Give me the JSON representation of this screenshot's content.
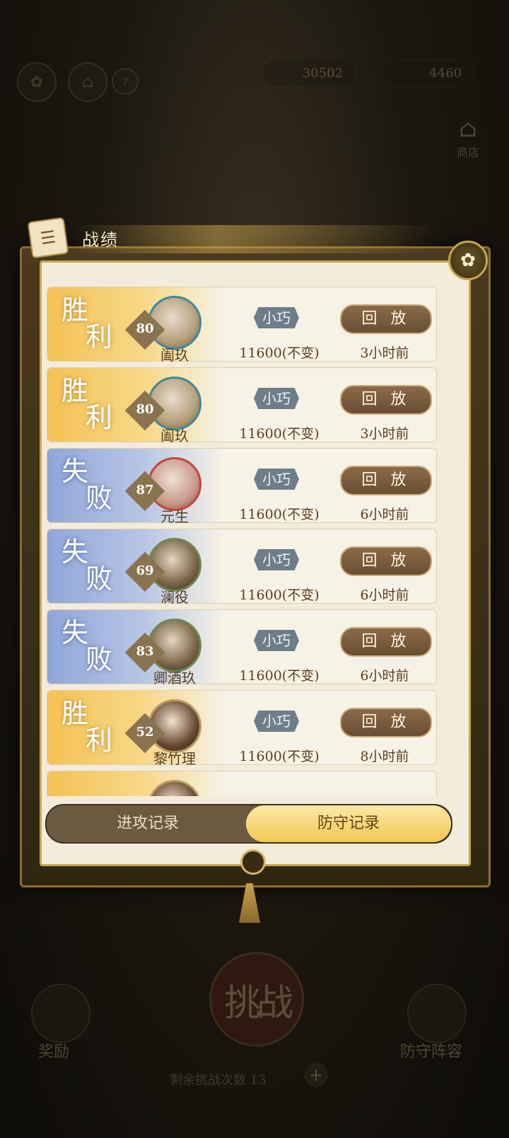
{
  "background": {
    "currency_1": "30502",
    "currency_2": "4460",
    "shop_label": "商店",
    "challenge_label": "挑战",
    "reward_label": "奖励",
    "defense_label": "防守阵容",
    "count_label": "剩余挑战次数 13"
  },
  "panel": {
    "title": "战绩",
    "close_icon": "close-icon"
  },
  "records": [
    {
      "result": "胜利",
      "result_c1": "胜",
      "result_c2": "利",
      "level": "80",
      "name": "阖玖",
      "tag": "小巧",
      "score": "11600(不变)",
      "replay": "回 放",
      "time": "3小时前"
    },
    {
      "result": "胜利",
      "result_c1": "胜",
      "result_c2": "利",
      "level": "80",
      "name": "阖玖",
      "tag": "小巧",
      "score": "11600(不变)",
      "replay": "回 放",
      "time": "3小时前"
    },
    {
      "result": "失败",
      "result_c1": "失",
      "result_c2": "败",
      "level": "87",
      "name": "元生",
      "tag": "小巧",
      "score": "11600(不变)",
      "replay": "回 放",
      "time": "6小时前"
    },
    {
      "result": "失败",
      "result_c1": "失",
      "result_c2": "败",
      "level": "69",
      "name": "澜役",
      "tag": "小巧",
      "score": "11600(不变)",
      "replay": "回 放",
      "time": "6小时前"
    },
    {
      "result": "失败",
      "result_c1": "失",
      "result_c2": "败",
      "level": "83",
      "name": "卿酒玖",
      "tag": "小巧",
      "score": "11600(不变)",
      "replay": "回 放",
      "time": "6小时前"
    },
    {
      "result": "胜利",
      "result_c1": "胜",
      "result_c2": "利",
      "level": "52",
      "name": "黎竹理",
      "tag": "小巧",
      "score": "11600(不变)",
      "replay": "回 放",
      "time": "8小时前"
    }
  ],
  "tabs": {
    "attack": "进攻记录",
    "defense": "防守记录",
    "active": "defense"
  }
}
